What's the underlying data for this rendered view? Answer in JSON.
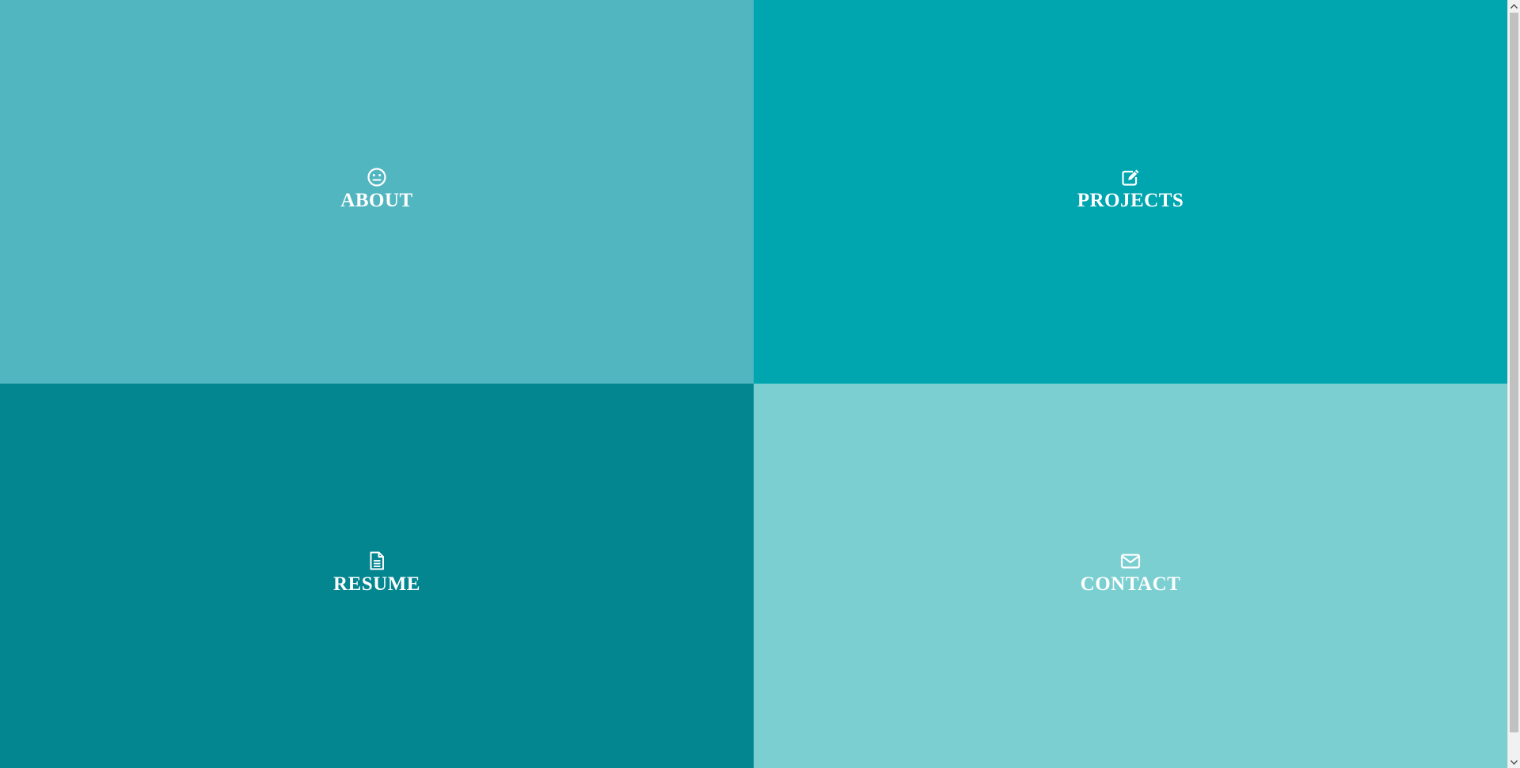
{
  "tiles": [
    {
      "key": "about",
      "label": "ABOUT",
      "icon": "neutral-face-icon",
      "color": "#52b6c1"
    },
    {
      "key": "projects",
      "label": "PROJECTS",
      "icon": "edit-icon",
      "color": "#00a6af"
    },
    {
      "key": "resume",
      "label": "RESUME",
      "icon": "document-icon",
      "color": "#038690"
    },
    {
      "key": "contact",
      "label": "CONTACT",
      "icon": "envelope-icon",
      "color": "#7bcfd1"
    }
  ]
}
